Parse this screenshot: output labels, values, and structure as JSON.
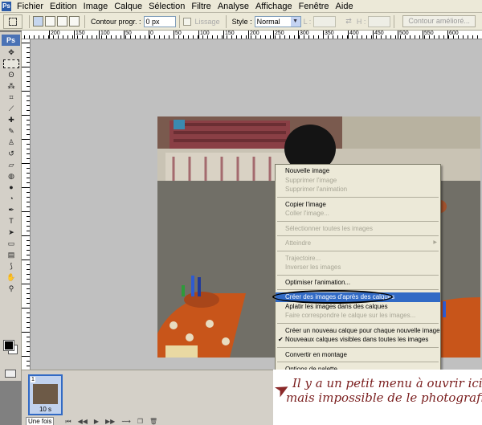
{
  "menubar": {
    "items": [
      "Fichier",
      "Edition",
      "Image",
      "Calque",
      "Sélection",
      "Filtre",
      "Analyse",
      "Affichage",
      "Fenêtre",
      "Aide"
    ]
  },
  "options": {
    "contour_label": "Contour progr. :",
    "contour_value": "0 px",
    "lissage_label": "Lissage",
    "style_label": "Style :",
    "style_value": "Normal",
    "l_label": "L :",
    "h_label": "H :",
    "contour_ameliore": "Contour amélioré..."
  },
  "toolbar": {
    "badge": "Ps",
    "tools": [
      "move-icon",
      "marquee-icon",
      "lasso-icon",
      "magic-wand-icon",
      "crop-icon",
      "slice-icon",
      "healing-icon",
      "brush-icon",
      "clone-stamp-icon",
      "history-brush-icon",
      "eraser-icon",
      "paint-bucket-icon",
      "blur-icon",
      "dodge-icon",
      "pen-icon",
      "type-icon",
      "path-select-icon",
      "shape-icon",
      "notes-icon",
      "eyedropper-icon",
      "hand-icon",
      "zoom-icon"
    ]
  },
  "ruler": {
    "top_labels": [
      "200",
      "150",
      "100",
      "50",
      "0",
      "50",
      "100",
      "150",
      "200",
      "250",
      "300",
      "350",
      "400",
      "450",
      "500",
      "550",
      "600"
    ]
  },
  "animation": {
    "frame_number": "1",
    "frame_delay": "10 s",
    "loop": "Une fois"
  },
  "context_menu": {
    "items": [
      {
        "label": "Nouvelle image",
        "disabled": false
      },
      {
        "label": "Supprimer l'image",
        "disabled": true
      },
      {
        "label": "Supprimer l'animation",
        "disabled": true
      },
      {
        "sep": true
      },
      {
        "label": "Copier l'image",
        "disabled": false
      },
      {
        "label": "Coller l'image...",
        "disabled": true
      },
      {
        "sep": true
      },
      {
        "label": "Sélectionner toutes les images",
        "disabled": true
      },
      {
        "sep": true
      },
      {
        "label": "Atteindre",
        "disabled": true,
        "submenu": true
      },
      {
        "sep": true
      },
      {
        "label": "Trajectoire...",
        "disabled": true
      },
      {
        "label": "Inverser les images",
        "disabled": true
      },
      {
        "sep": true
      },
      {
        "label": "Optimiser l'animation...",
        "disabled": false
      },
      {
        "sep": true
      },
      {
        "label": "Créer des images d'après des calques",
        "disabled": false,
        "highlighted": true
      },
      {
        "label": "Aplatir les images dans des calques",
        "disabled": false
      },
      {
        "label": "Faire correspondre le calque sur les images...",
        "disabled": true
      },
      {
        "sep": true
      },
      {
        "label": "Créer un nouveau calque pour chaque nouvelle image",
        "disabled": false
      },
      {
        "label": "Nouveaux calques visibles dans toutes les images",
        "disabled": false,
        "checked": true
      },
      {
        "sep": true
      },
      {
        "label": "Convertir en montage",
        "disabled": false
      },
      {
        "sep": true
      },
      {
        "label": "Options de palette...",
        "disabled": false
      }
    ]
  },
  "annotation": {
    "line1": "Il y a un petit menu à ouvrir ici,",
    "line2": "mais impossible de le photografier"
  }
}
